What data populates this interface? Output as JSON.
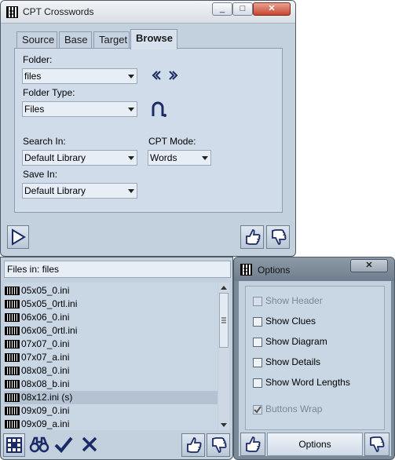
{
  "main_window": {
    "title": "CPT Crosswords",
    "minimize": "_",
    "maximize": "□",
    "close": "✕",
    "tabs": [
      {
        "label": "Source"
      },
      {
        "label": "Base"
      },
      {
        "label": "Target"
      },
      {
        "label": "Browse",
        "active": true
      }
    ],
    "folder_label": "Folder:",
    "folder_value": "files",
    "folder_type_label": "Folder Type:",
    "folder_type_value": "Files",
    "search_in_label": "Search In:",
    "search_in_value": "Default Library",
    "cpt_mode_label": "CPT Mode:",
    "cpt_mode_value": "Words",
    "save_in_label": "Save In:",
    "save_in_value": "Default Library"
  },
  "file_panel": {
    "header": "Files in: files",
    "files": [
      "05x05_0.ini",
      "05x05_0rtl.ini",
      "06x06_0.ini",
      "06x06_0rtl.ini",
      "07x07_0.ini",
      "07x07_a.ini",
      "08x08_0.ini",
      "08x08_b.ini",
      "08x12.ini (s)",
      "09x09_0.ini",
      "09x09_a.ini"
    ],
    "selected_index": 8
  },
  "options_window": {
    "title": "Options",
    "close": "✕",
    "checkboxes": [
      {
        "label": "Show Header",
        "checked": false,
        "disabled": true
      },
      {
        "label": "Show Clues",
        "checked": false,
        "disabled": false
      },
      {
        "label": "Show Diagram",
        "checked": false,
        "disabled": false
      },
      {
        "label": "Show Details",
        "checked": false,
        "disabled": false
      },
      {
        "label": "Show Word Lengths",
        "checked": false,
        "disabled": false
      },
      {
        "label": "Buttons Wrap",
        "checked": true,
        "disabled": true
      }
    ],
    "options_button": "Options"
  },
  "colors": {
    "panel_bg": "#c3d0de",
    "selection": "#b4c2d2",
    "icon_blue": "#1b2b66"
  },
  "icons": [
    "play-icon",
    "thumbs-up-icon",
    "thumbs-down-icon",
    "grid-icon",
    "binoculars-icon",
    "check-icon",
    "cross-icon",
    "back-icon",
    "forward-icon",
    "magnet-icon"
  ]
}
